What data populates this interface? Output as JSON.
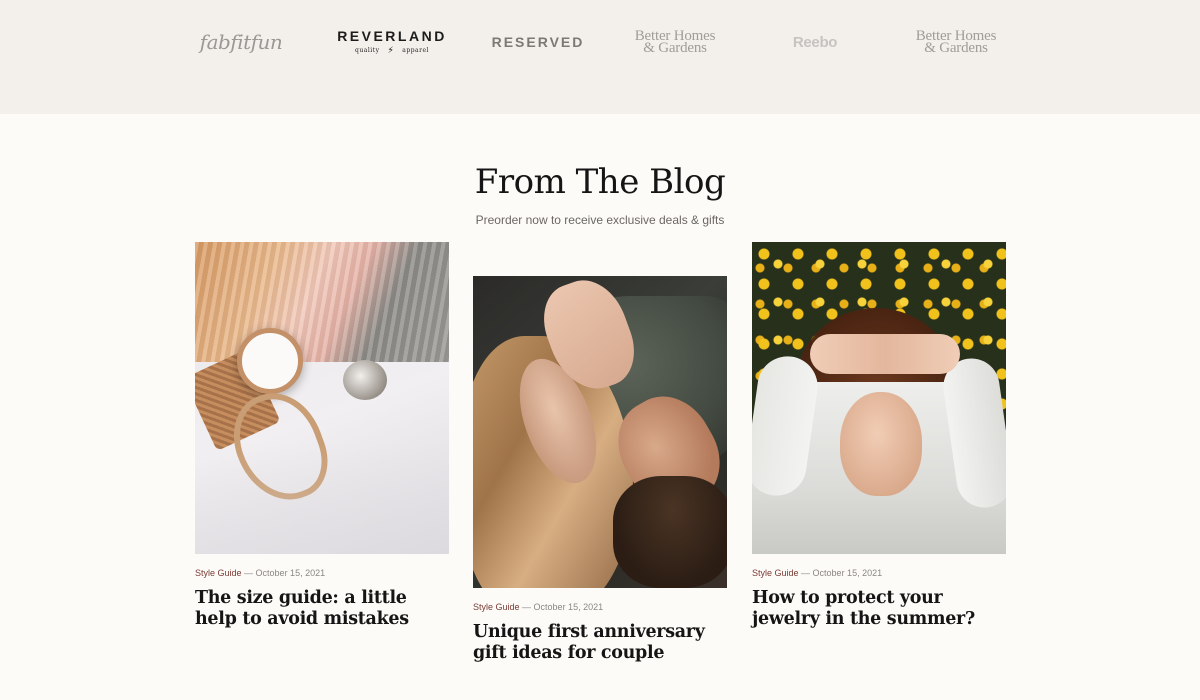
{
  "brands": {
    "logo_1": "fabfitfun",
    "logo_2_name": "REVERLAND",
    "logo_2_tag_left": "quality",
    "logo_2_tag_right": "apparel",
    "logo_3": "RESERVED",
    "logo_4_line1": "Better Homes",
    "logo_4_line2": "& Gardens",
    "logo_5": "Reebo",
    "logo_6_line1": "Better Homes",
    "logo_6_line2": "& Gardens"
  },
  "blog": {
    "title": "From The Blog",
    "subtitle": "Preorder now to receive exclusive deals & gifts",
    "posts": [
      {
        "category": "Style Guide",
        "date": "— October 15, 2021",
        "title": "The size guide: a little help to avoid mistakes",
        "image": "jewelry-and-watch-photo"
      },
      {
        "category": "Style Guide",
        "date": "— October 15, 2021",
        "title": "Unique first anniversary gift ideas for couple",
        "image": "couple-lying-together-photo"
      },
      {
        "category": "Style Guide",
        "date": "— October 15, 2021",
        "title": "How to protect your jewelry in the summer?",
        "image": "woman-in-yellow-flowers-photo"
      }
    ]
  },
  "colors": {
    "page_background": "#fdfbf8",
    "logo_strip_background": "#f3f0ec",
    "category_accent": "#7a3b34",
    "heading": "#151515",
    "muted_text": "#8a8783"
  }
}
